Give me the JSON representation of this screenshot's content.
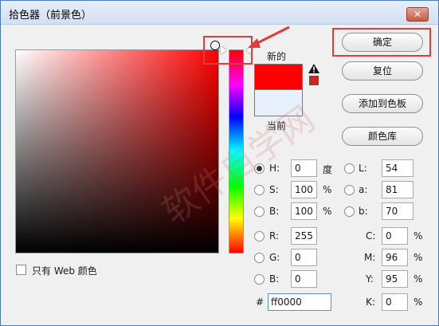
{
  "window": {
    "title": "拾色器（前景色）",
    "close_glyph": "✕"
  },
  "swatch": {
    "new_label": "新的",
    "current_label": "当前",
    "new_color": "#ff0000",
    "current_color": "#e8f0fb"
  },
  "buttons": {
    "ok": "确定",
    "reset": "复位",
    "add_to_swatches": "添加到色板",
    "color_libraries": "颜色库"
  },
  "hsb": {
    "h": {
      "label": "H:",
      "value": "0",
      "unit": "度",
      "selected": true
    },
    "s": {
      "label": "S:",
      "value": "100",
      "unit": "%"
    },
    "b": {
      "label": "B:",
      "value": "100",
      "unit": "%"
    }
  },
  "rgb": {
    "r": {
      "label": "R:",
      "value": "255"
    },
    "g": {
      "label": "G:",
      "value": "0"
    },
    "b": {
      "label": "B:",
      "value": "0"
    }
  },
  "lab": {
    "l": {
      "label": "L:",
      "value": "54"
    },
    "a": {
      "label": "a:",
      "value": "81"
    },
    "b": {
      "label": "b:",
      "value": "70"
    }
  },
  "cmyk": {
    "c": {
      "label": "C:",
      "value": "0",
      "unit": "%"
    },
    "m": {
      "label": "M:",
      "value": "96",
      "unit": "%"
    },
    "y": {
      "label": "Y:",
      "value": "95",
      "unit": "%"
    },
    "k": {
      "label": "K:",
      "value": "0",
      "unit": "%"
    }
  },
  "hex": {
    "label": "#",
    "value": "ff0000"
  },
  "web_only": {
    "label": "只有 Web 颜色",
    "checked": false
  },
  "watermark": "软件自学网"
}
